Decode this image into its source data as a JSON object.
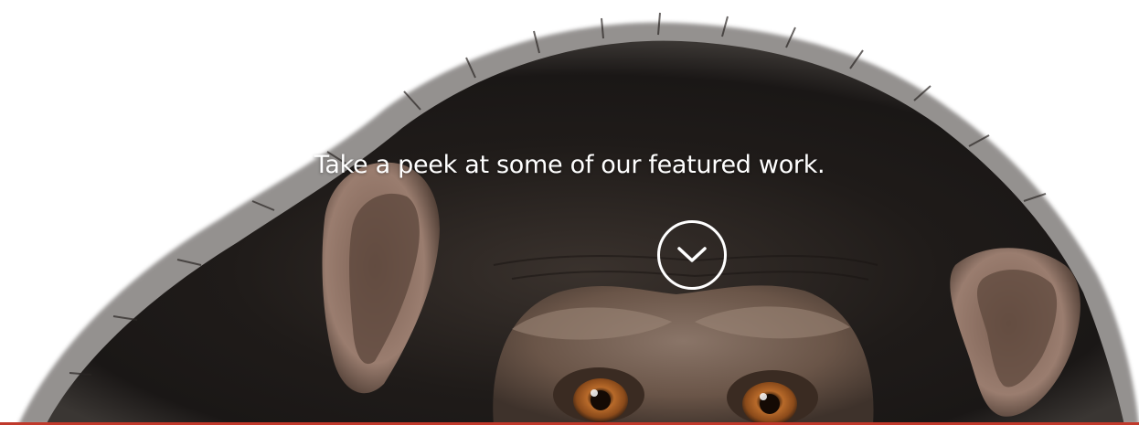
{
  "hero": {
    "headline": "Take a peek at some of our featured work.",
    "scroll_button_icon": "chevron-down-icon",
    "image_subject": "chimpanzee-portrait"
  },
  "colors": {
    "text": "#ffffff",
    "bottom_rule": "#c0392b"
  }
}
